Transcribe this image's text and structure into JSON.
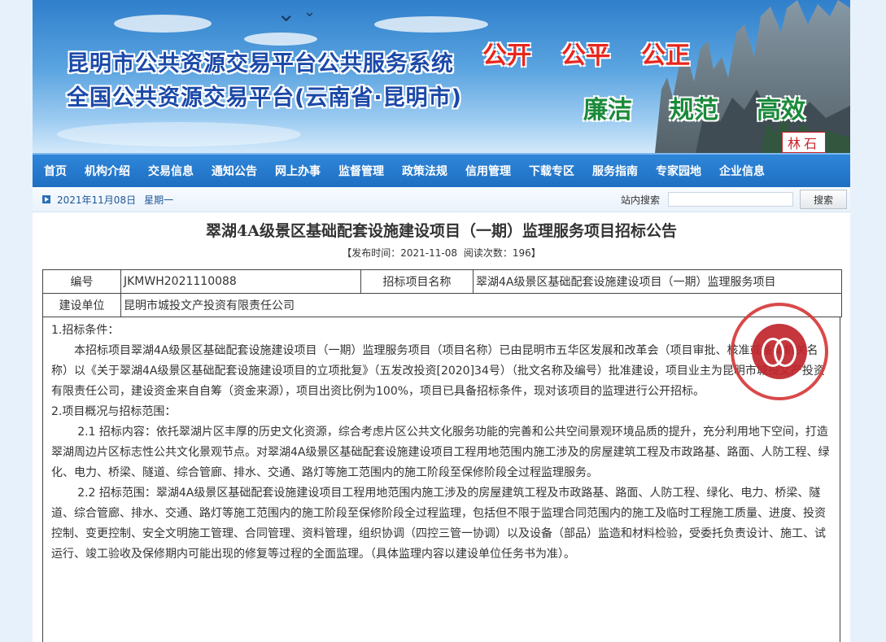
{
  "banner": {
    "line1": "昆明市公共资源交易平台公共服务系统",
    "line2": "全国公共资源交易平台(云南省·昆明市)",
    "slogans_red": [
      "公开",
      "公平",
      "公正"
    ],
    "slogans_green": [
      "廉洁",
      "规范",
      "高效"
    ],
    "sign_text": "林石",
    "colors": {
      "title": "#1b49a8",
      "red": "#e8261d",
      "green": "#1a8a3a"
    }
  },
  "nav": {
    "items": [
      "首页",
      "机构介绍",
      "交易信息",
      "通知公告",
      "网上办事",
      "监督管理",
      "政策法规",
      "信用管理",
      "下载专区",
      "服务指南",
      "专家园地",
      "企业信息"
    ]
  },
  "datebar": {
    "date": "2021年11月08日",
    "weekday": "星期一",
    "search_label": "站内搜索",
    "search_value": "",
    "search_button": "搜索"
  },
  "article": {
    "title": "翠湖4A级景区基础配套设施建设项目（一期）监理服务项目招标公告",
    "meta_publish": "【发布时间：2021-11-08",
    "meta_reads": "阅读次数：196】",
    "table": {
      "r1c1": "编号",
      "r1c2": "JKMWH2021110088",
      "r1c3": "招标项目名称",
      "r1c4": "翠湖4A级景区基础配套设施建设项目（一期）监理服务项目",
      "r2c1": "建设单位",
      "r2c2": "昆明市城投文产投资有限责任公司"
    },
    "paragraphs": [
      "1.招标条件：",
      "本招标项目翠湖4A级景区基础配套设施建设项目（一期）监理服务项目（项目名称）已由昆明市五华区发展和改革会（项目审批、核准或备案机关名称）以《关于翠湖4A级景区基础配套设施建设项目的立项批复》（五发改投资[2020]34号）（批文名称及编号）批准建设，项目业主为昆明市城投文产投资有限责任公司，建设资金来自自筹（资金来源），项目出资比例为100%，项目已具备招标条件，现对该项目的监理进行公开招标。",
      "2.项目概况与招标范围：",
      "2.1 招标内容：依托翠湖片区丰厚的历史文化资源，综合考虑片区公共文化服务功能的完善和公共空间景观环境品质的提升，充分利用地下空间，打造翠湖周边片区标志性公共文化景观节点。对翠湖4A级景区基础配套设施建设项目工程用地范围内施工涉及的房屋建筑工程及市政路基、路面、人防工程、绿化、电力、桥梁、隧道、综合管廊、排水、交通、路灯等施工范围内的施工阶段至保修阶段全过程监理服务。",
      "2.2 招标范围：翠湖4A级景区基础配套设施建设项目工程用地范围内施工涉及的房屋建筑工程及市政路基、路面、人防工程、绿化、电力、桥梁、隧道、综合管廊、排水、交通、路灯等施工范围内的施工阶段至保修阶段全过程监理，包括但不限于监理合同范围内的施工及临时工程施工质量、进度、投资控制、变更控制、安全文明施工管理、合同管理、资料管理，组织协调（四控三管一协调）以及设备（部品）监造和材料检验，受委托负责设计、施工、试运行、竣工验收及保修期内可能出现的修复等过程的全面监理。（具体监理内容以建设单位任务书为准）。"
    ]
  }
}
